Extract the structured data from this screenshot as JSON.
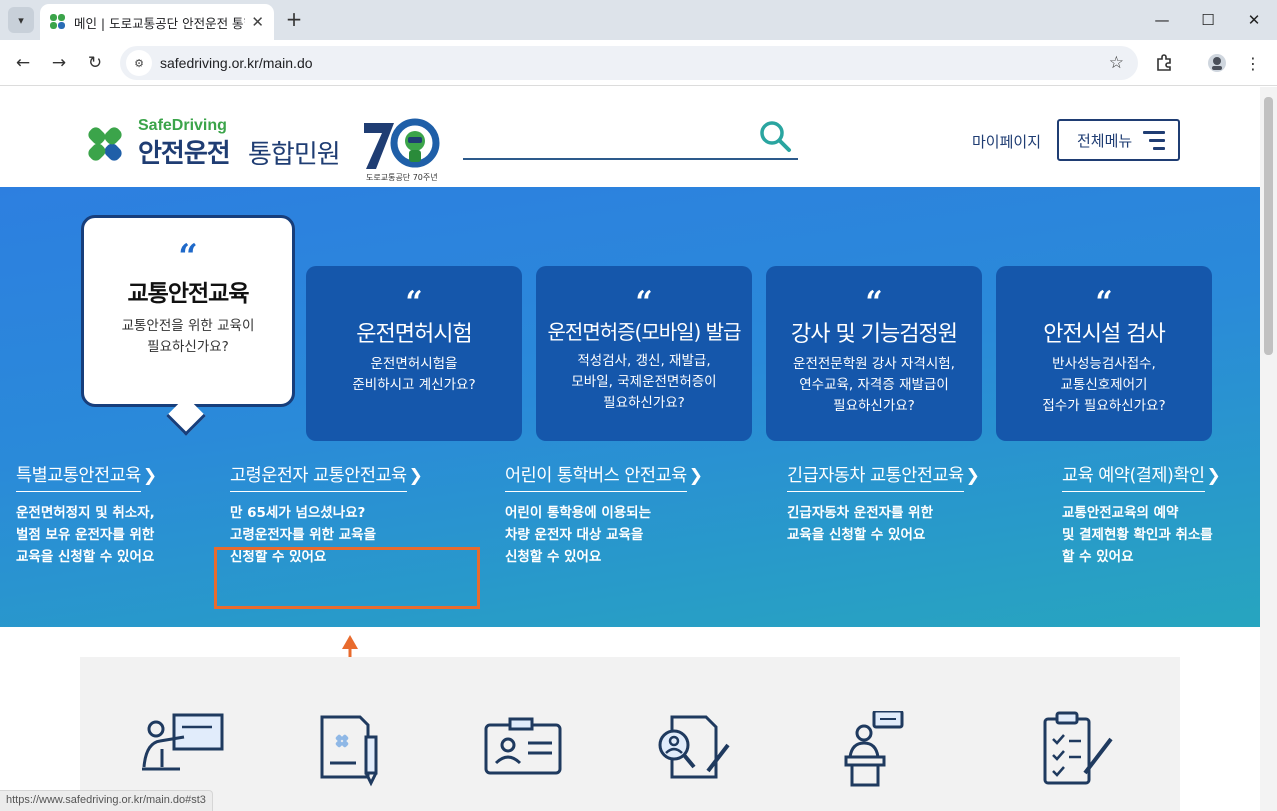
{
  "browser": {
    "tab_title": "메인 | 도로교통공단 안전운전 통합민원",
    "url": "safedriving.or.kr/main.do",
    "status_url": "https://www.safedriving.or.kr/main.do#st3"
  },
  "header": {
    "logo_sub": "SafeDriving",
    "logo_main": "안전운전",
    "logo_sub2": "통합민원",
    "anniversary": "도로교통공단 70주년",
    "mypage": "마이페이지",
    "menu": "전체메뉴"
  },
  "hero": {
    "quote_mark": "“",
    "bubble": {
      "title": "교통안전교육",
      "desc_line1": "교통안전을 위한 교육이",
      "desc_line2": "필요하신가요?"
    },
    "cards": [
      {
        "title": "운전면허시험",
        "lines": [
          "운전면허시험을",
          "준비하시고 계신가요?"
        ]
      },
      {
        "title": "운전면허증(모바일) 발급",
        "lines": [
          "적성검사, 갱신, 재발급,",
          "모바일, 국제운전면허증이",
          "필요하신가요?"
        ]
      },
      {
        "title": "강사 및 기능검정원",
        "lines": [
          "운전전문학원 강사 자격시험,",
          "연수교육, 자격증 재발급이",
          "필요하신가요?"
        ]
      },
      {
        "title": "안전시설 검사",
        "lines": [
          "반사성능검사접수,",
          "교통신호제어기",
          "접수가 필요하신가요?"
        ]
      }
    ],
    "links": [
      {
        "title": "특별교통안전교육",
        "lines": [
          "운전면허정지 및 취소자,",
          "벌점 보유 운전자를 위한",
          "교육을 신청할 수 있어요"
        ]
      },
      {
        "title": "고령운전자 교통안전교육",
        "lines": [
          "만 65세가 넘으셨나요?",
          "고령운전자를 위한 교육을",
          "신청할 수 있어요"
        ]
      },
      {
        "title": "어린이 통학버스 안전교육",
        "lines": [
          "어린이 통학용에 이용되는",
          "차량 운전자 대상 교육을",
          "신청할 수 있어요"
        ]
      },
      {
        "title": "긴급자동차 교통안전교육",
        "lines": [
          "긴급자동차 운전자를 위한",
          "교육을 신청할 수 있어요"
        ]
      },
      {
        "title": "교육 예약(결제)확인",
        "lines": [
          "교통안전교육의 예약",
          "및 결제현황 확인과 취소를",
          "할 수 있어요"
        ]
      }
    ]
  },
  "colors": {
    "brand_navy": "#1f3d73",
    "brand_green": "#3ba44a",
    "card_blue": "#1557ab",
    "highlight": "#e86b2e"
  }
}
